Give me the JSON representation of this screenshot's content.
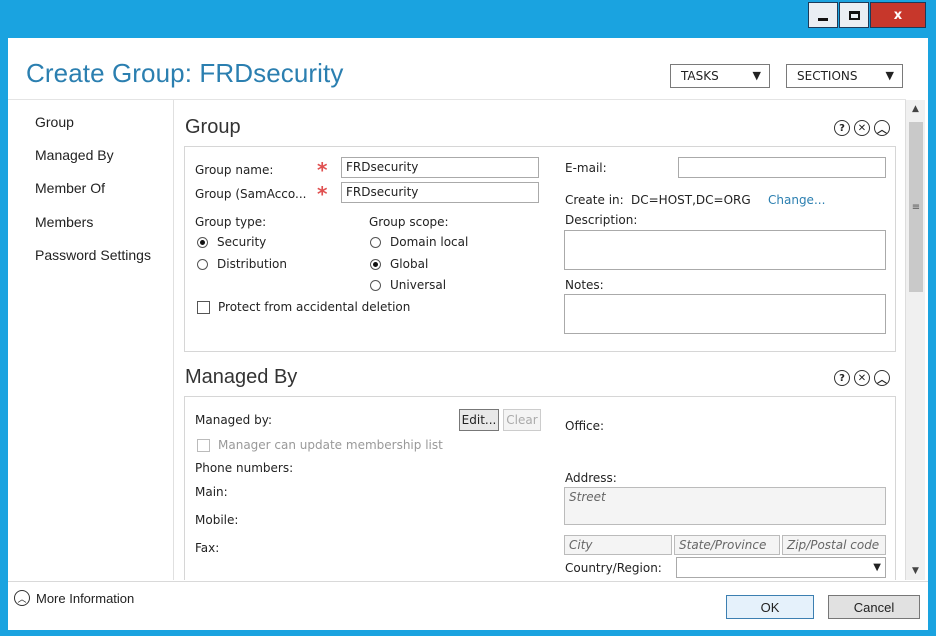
{
  "window": {
    "title": "Create Group: FRDsecurity",
    "close_glyph": "x"
  },
  "header": {
    "tasks_label": "TASKS",
    "sections_label": "SECTIONS"
  },
  "nav": {
    "items": [
      {
        "label": "Group"
      },
      {
        "label": "Managed By"
      },
      {
        "label": "Member Of"
      },
      {
        "label": "Members"
      },
      {
        "label": "Password Settings"
      }
    ]
  },
  "group_section": {
    "title": "Group",
    "group_name_label": "Group name:",
    "group_name_value": "FRDsecurity",
    "sam_label": "Group (SamAcco...",
    "sam_value": "FRDsecurity",
    "group_type_label": "Group type:",
    "type_security": "Security",
    "type_distribution": "Distribution",
    "group_scope_label": "Group scope:",
    "scope_domain_local": "Domain local",
    "scope_global": "Global",
    "scope_universal": "Universal",
    "protect_label": "Protect from accidental deletion",
    "email_label": "E-mail:",
    "email_value": "",
    "create_in_label": "Create in:",
    "create_in_value": "DC=HOST,DC=ORG",
    "change_link": "Change...",
    "description_label": "Description:",
    "notes_label": "Notes:"
  },
  "managed_section": {
    "title": "Managed By",
    "managed_by_label": "Managed by:",
    "edit_button": "Edit...",
    "clear_button": "Clear",
    "manager_update_label": "Manager can update membership list",
    "phone_numbers_label": "Phone numbers:",
    "main_label": "Main:",
    "mobile_label": "Mobile:",
    "fax_label": "Fax:",
    "office_label": "Office:",
    "address_label": "Address:",
    "street_placeholder": "Street",
    "city_placeholder": "City",
    "state_placeholder": "State/Province",
    "zip_placeholder": "Zip/Postal code",
    "country_label": "Country/Region:"
  },
  "footer": {
    "more_info": "More Information",
    "ok_label": "OK",
    "cancel_label": "Cancel"
  },
  "colors": {
    "accent": "#1aa3e0",
    "title_text": "#2b7fb0",
    "required_star": "#e05050",
    "close_red": "#c7372b"
  },
  "icons": {
    "minimize": "minimize-icon",
    "maximize": "maximize-icon",
    "close": "close-icon",
    "help": "help-icon",
    "section_close": "close-circle-icon",
    "collapse": "chevron-up-circle-icon"
  }
}
